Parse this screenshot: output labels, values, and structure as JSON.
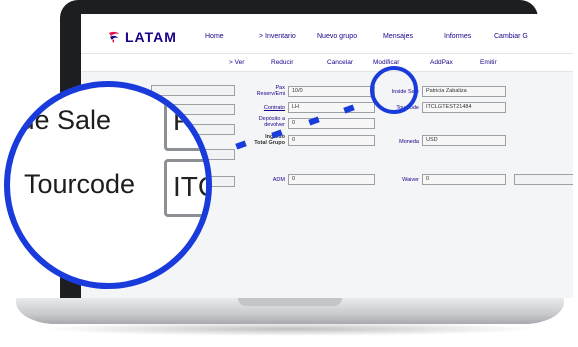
{
  "brand": {
    "logo_text": "LATAM",
    "logo_color": "#1b0088",
    "accent_color": "#1a3bdc"
  },
  "top_nav": {
    "items": [
      "Home",
      "> Inventario",
      "Nuevo grupo",
      "Mensajes",
      "Informes",
      "Cambiar G"
    ]
  },
  "sub_nav": {
    "items": [
      "> Ver",
      "Reducir",
      "Cancelar",
      "Modificar",
      "AddPax",
      "Emitir"
    ]
  },
  "form": {
    "pax_label": "Pax\nReserv/Emi",
    "pax_value": "10/0",
    "contrato_label": "Contrato",
    "contrato_value": "LH",
    "deposito_label": "Depósito a\ndevolver",
    "deposito_value": "0",
    "ingreso_label": "Ingreso\nTotal Grupo",
    "ingreso_value": "0",
    "inside_sale_label": "Inside Sale",
    "inside_sale_value": "Patricia Zabaliza",
    "tourcode_label": "Tourcode",
    "tourcode_value": "ITCLGTEST21484",
    "moneda_label": "Moneda",
    "moneda_value": "USD",
    "adm_label": "ADM",
    "adm_value": "0",
    "waiver_label": "Waiver",
    "waiver_value": "0"
  },
  "zoom": {
    "inside_sale_label": "side Sale",
    "inside_sale_value": "P",
    "tourcode_label": "Tourcode",
    "tourcode_value": "ITC"
  }
}
